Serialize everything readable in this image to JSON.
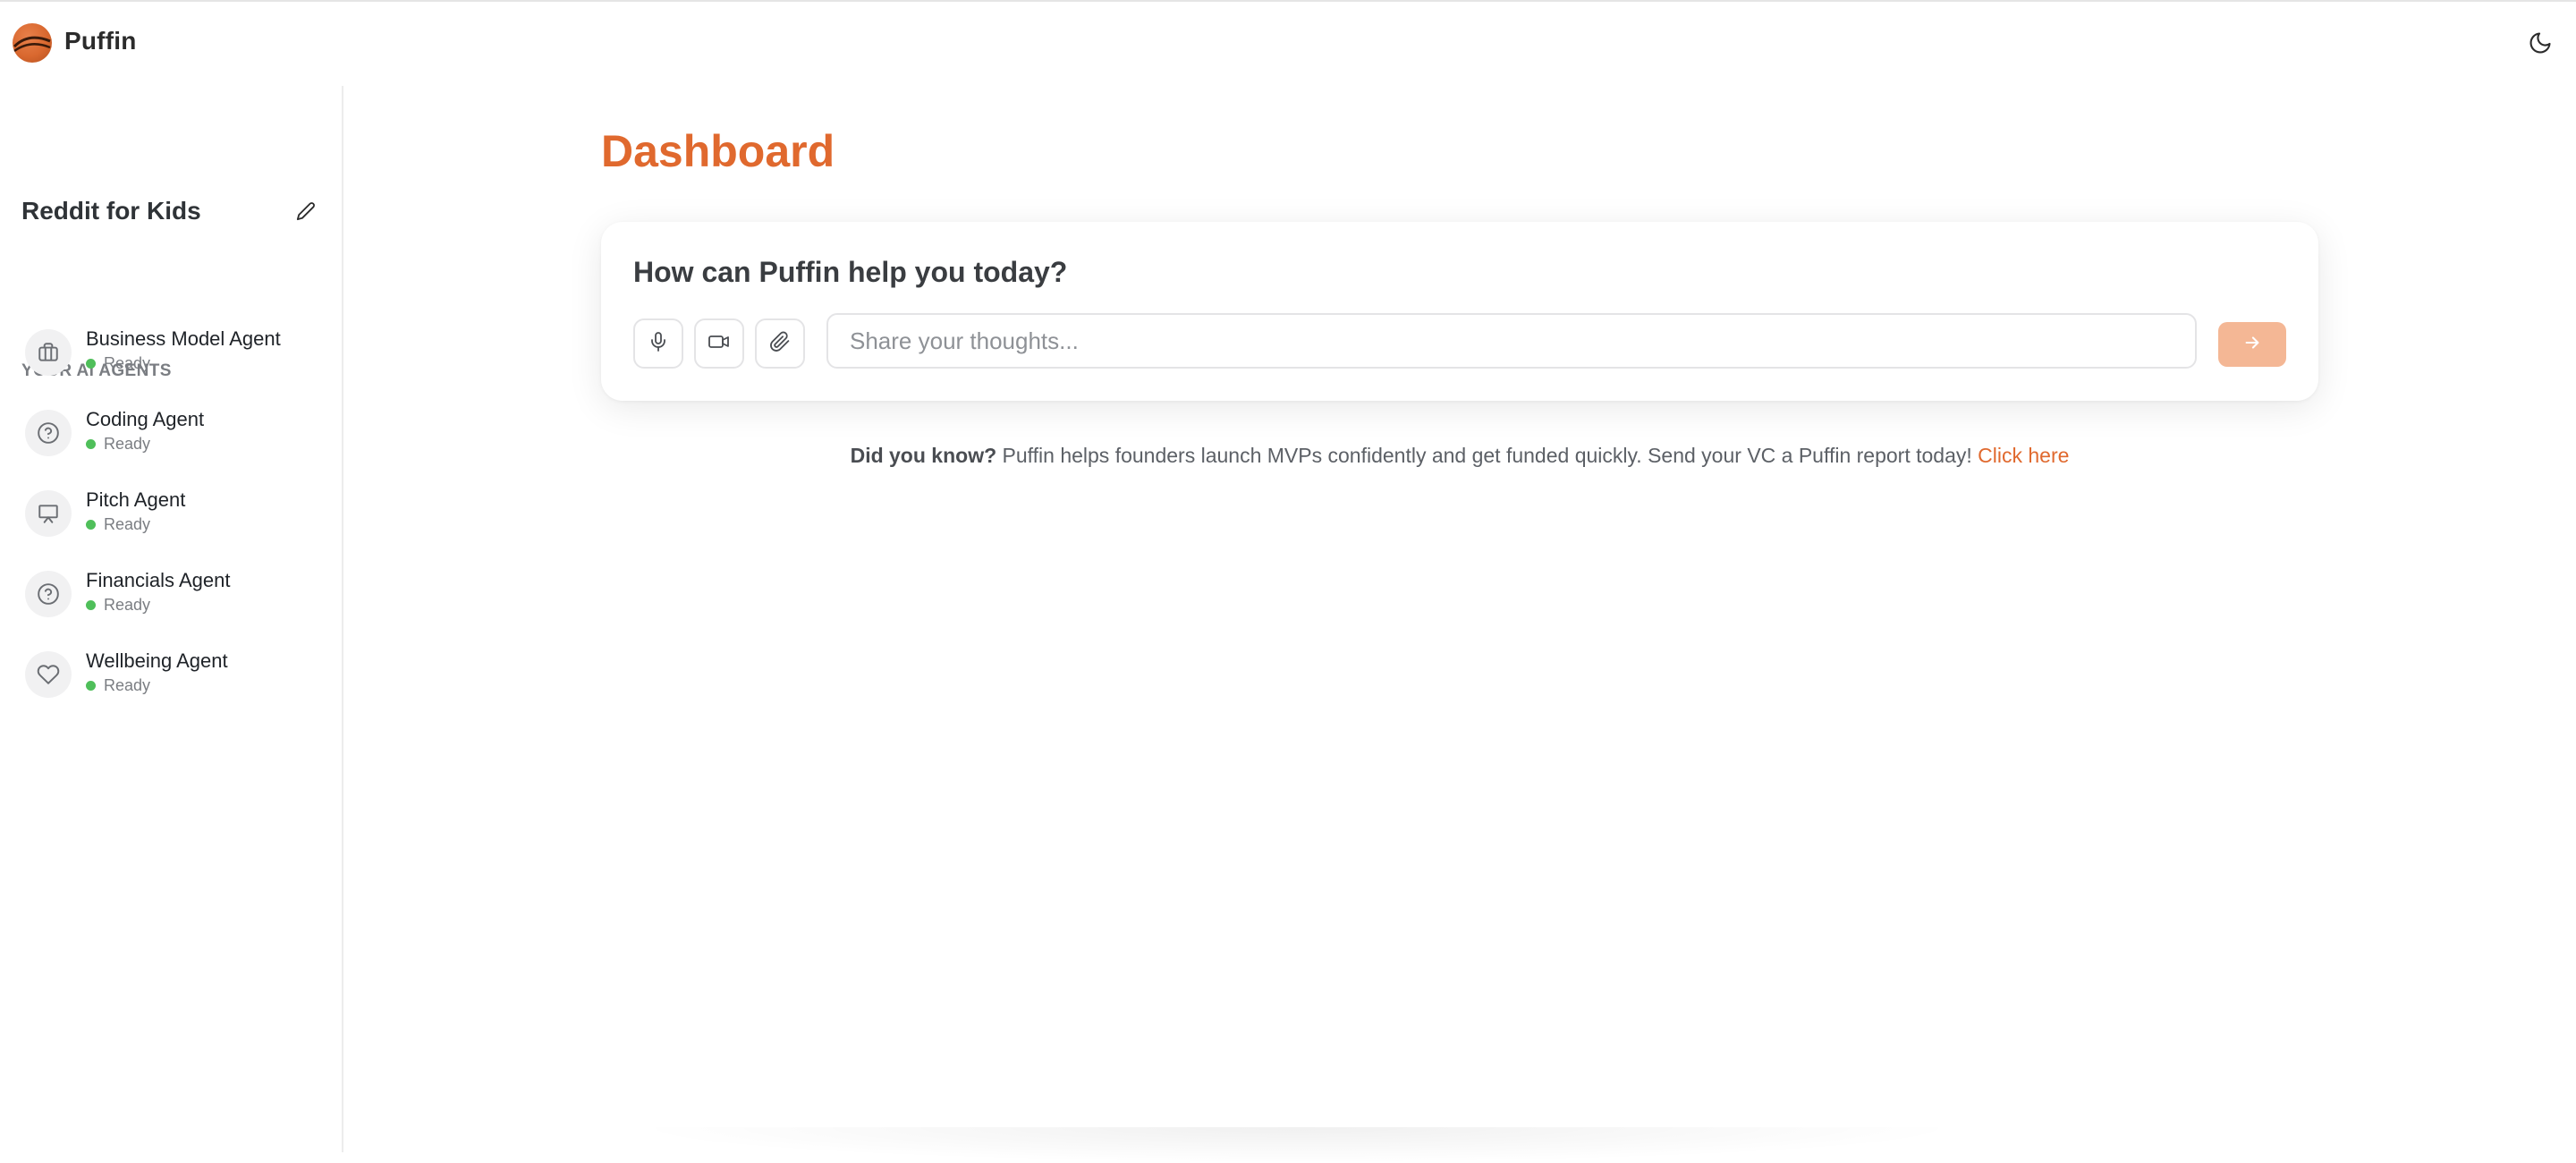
{
  "app": {
    "name": "Puffin"
  },
  "sidebar": {
    "project_title": "Reddit for Kids",
    "section_label": "YOUR AI AGENTS",
    "agents": [
      {
        "name": "Business Model Agent",
        "status": "Ready",
        "icon": "briefcase-icon"
      },
      {
        "name": "Coding Agent",
        "status": "Ready",
        "icon": "help-circle-icon"
      },
      {
        "name": "Pitch Agent",
        "status": "Ready",
        "icon": "presentation-icon"
      },
      {
        "name": "Financials Agent",
        "status": "Ready",
        "icon": "help-circle-icon"
      },
      {
        "name": "Wellbeing Agent",
        "status": "Ready",
        "icon": "heart-icon"
      }
    ]
  },
  "main": {
    "title": "Dashboard",
    "prompt_heading": "How can Puffin help you today?",
    "input_placeholder": "Share your thoughts...",
    "tip_bold": "Did you know?",
    "tip_text": " Puffin helps founders launch MVPs confidently and get funded quickly. Send your VC a Puffin report today! ",
    "tip_link": "Click here"
  },
  "colors": {
    "accent": "#e0692e",
    "send_button": "#f4b795",
    "status_ready": "#4fbf5a"
  }
}
